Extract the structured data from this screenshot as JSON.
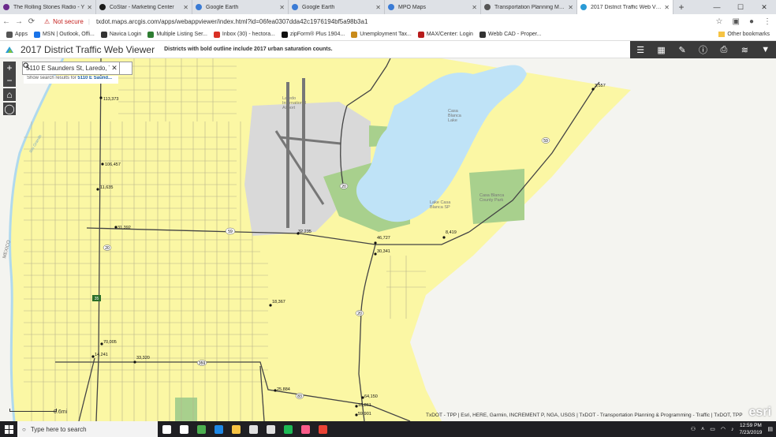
{
  "browser": {
    "tabs": [
      {
        "label": "The Rolling Stones Radio - Y",
        "icon": "pandora-icon",
        "color": "#6b2a8c",
        "active": false
      },
      {
        "label": "CoStar - Marketing Center",
        "icon": "costar-icon",
        "color": "#1a1a1a",
        "active": false
      },
      {
        "label": "Google Earth",
        "icon": "google-earth-icon",
        "color": "#3a7bd5",
        "active": false
      },
      {
        "label": "Google Earth",
        "icon": "google-earth-icon",
        "color": "#3a7bd5",
        "active": false
      },
      {
        "label": "MPO Maps",
        "icon": "arcgis-icon",
        "color": "#3a7bd5",
        "active": false
      },
      {
        "label": "Transportation Planning Maps",
        "icon": "globe-icon",
        "color": "#555",
        "active": false
      },
      {
        "label": "2017 District Traffic Web Viewer",
        "icon": "arcgis-icon",
        "color": "#2b9bd6",
        "active": true
      }
    ],
    "new_tab": "+",
    "window": {
      "minimize": "—",
      "maximize": "☐",
      "close": "✕"
    },
    "address": {
      "security": "Not secure",
      "url": "txdot.maps.arcgis.com/apps/webappviewer/index.html?id=06fea0307dda42c1976194bf5a98b3a1"
    },
    "bookmarks": [
      {
        "label": "Apps",
        "color": "#555"
      },
      {
        "label": "MSN | Outlook, Offi...",
        "color": "#1a73e8"
      },
      {
        "label": "Navica Login",
        "color": "#333"
      },
      {
        "label": "Multiple Listing Ser...",
        "color": "#2e7d32"
      },
      {
        "label": "Inbox (30) - hectora...",
        "color": "#d93025"
      },
      {
        "label": "zipForm® Plus 1904...",
        "color": "#111"
      },
      {
        "label": "Unemployment Tax...",
        "color": "#c98b1a"
      },
      {
        "label": "MAX/Center: Login",
        "color": "#b71c1c"
      },
      {
        "label": "Webb CAD - Proper...",
        "color": "#333"
      }
    ],
    "other_bookmarks": "Other bookmarks"
  },
  "app": {
    "title": "2017 District Traffic Web Viewer",
    "subtitle": "Districts with bold outline include 2017 urban saturation counts.",
    "toolbar": [
      "list-icon",
      "grid-icon",
      "pencil-icon",
      "info-icon",
      "print-icon",
      "layers-icon",
      "filter-icon"
    ]
  },
  "map": {
    "zoom_in": "+",
    "zoom_out": "−",
    "search_value": "5110 E Saunders St, Laredo, TX",
    "search_hint_prefix": "Show search results for",
    "search_hint_value": "5110 E Saund...",
    "scale_label": "0.6mi",
    "attribution": "TxDOT - TPP | Esri, HERE, Garmin, INCREMENT P, NGA, USGS | TxDOT - Transportation Planning & Programming - Traffic | TxDOT, TPP",
    "esri": "esri",
    "place_labels": [
      "Laredo International Airport",
      "Casa Blanca Lake",
      "Lake Casa Blanca SP",
      "Casa Blanca County Park",
      "Rio Grande",
      "MEXICO"
    ],
    "counts": [
      "113,373",
      "106,457",
      "11,635",
      "31,392",
      "32,235",
      "46,727",
      "30,341",
      "8,419",
      "3,557",
      "18,367",
      "70,005",
      "33,320",
      "14,241",
      "25,884",
      "64,150",
      "18,861",
      "59,901"
    ],
    "shields": [
      "59",
      "20",
      "20",
      "59",
      "35",
      "359",
      "83",
      "20"
    ]
  },
  "taskbar": {
    "search_placeholder": "Type here to search",
    "apps": [
      {
        "name": "cortana-icon",
        "color": "#ffffff"
      },
      {
        "name": "task-view-icon",
        "color": "#ffffff"
      },
      {
        "name": "webex-icon",
        "color": "#4caf50"
      },
      {
        "name": "edge-icon",
        "color": "#1e88e5"
      },
      {
        "name": "file-explorer-icon",
        "color": "#f6c343"
      },
      {
        "name": "mail-icon",
        "color": "#e0e0e0"
      },
      {
        "name": "store-icon",
        "color": "#e0e0e0"
      },
      {
        "name": "spotify-icon",
        "color": "#1db954"
      },
      {
        "name": "itunes-icon",
        "color": "#fa5c8a"
      },
      {
        "name": "chrome-icon",
        "color": "#ea4335"
      }
    ],
    "time": "12:59 PM",
    "date": "7/23/2019"
  }
}
